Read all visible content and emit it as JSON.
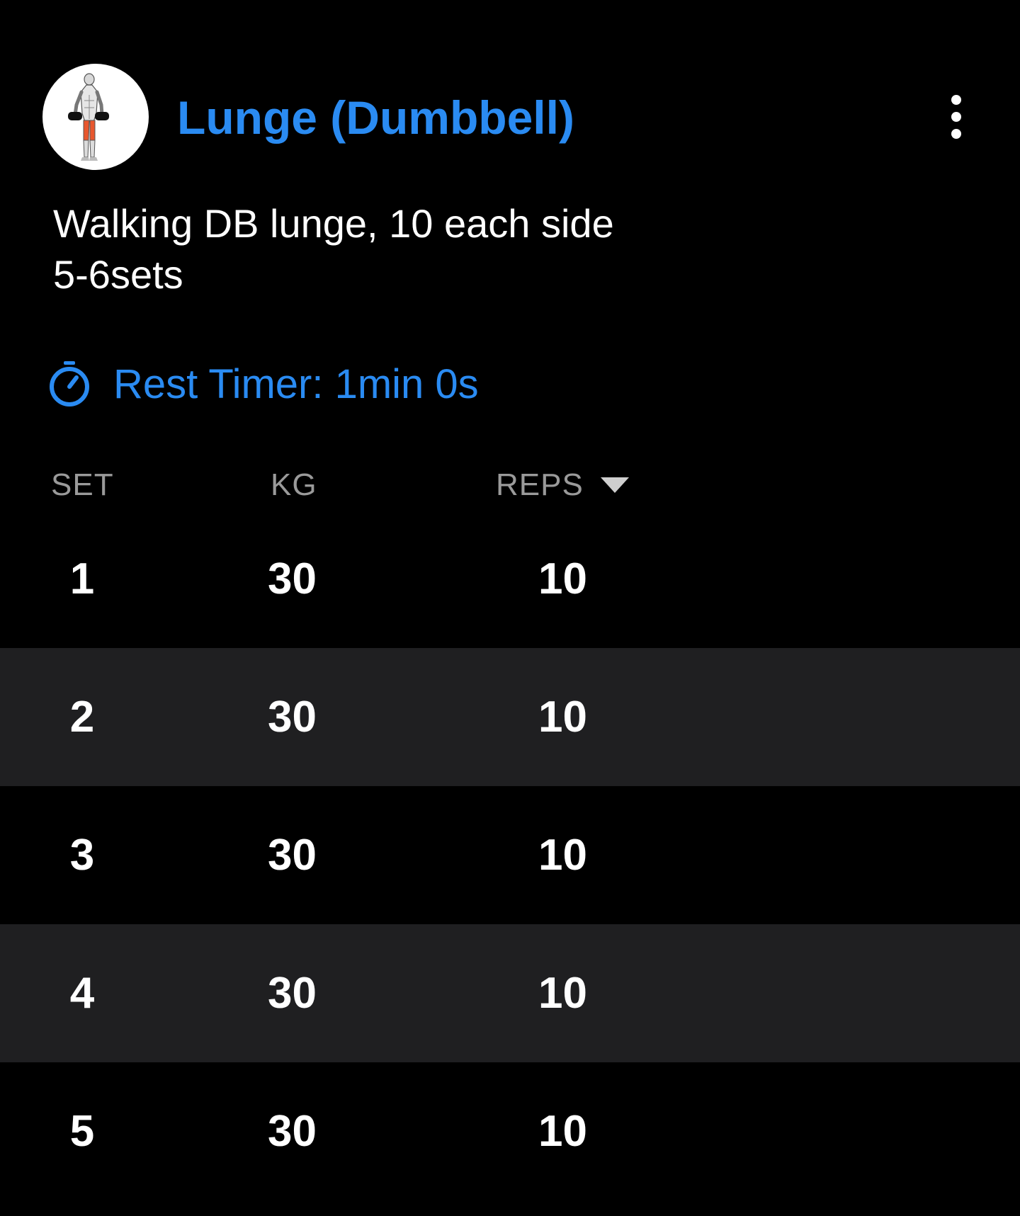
{
  "header": {
    "title": "Lunge (Dumbbell)",
    "accent_color": "#2a8bf2",
    "avatar_icon": "exercise-lunge-illustration",
    "menu_icon": "more-vertical-icon"
  },
  "notes": {
    "line1": "Walking DB lunge, 10 each side",
    "line2": "5-6sets"
  },
  "rest_timer": {
    "icon": "stopwatch-icon",
    "label": "Rest Timer: 1min 0s"
  },
  "table": {
    "headers": {
      "set": "SET",
      "kg": "KG",
      "reps": "REPS"
    },
    "rows": [
      {
        "set": "1",
        "kg": "30",
        "reps": "10"
      },
      {
        "set": "2",
        "kg": "30",
        "reps": "10"
      },
      {
        "set": "3",
        "kg": "30",
        "reps": "10"
      },
      {
        "set": "4",
        "kg": "30",
        "reps": "10"
      },
      {
        "set": "5",
        "kg": "30",
        "reps": "10"
      }
    ],
    "alt_row_color": "#1f1f21"
  }
}
